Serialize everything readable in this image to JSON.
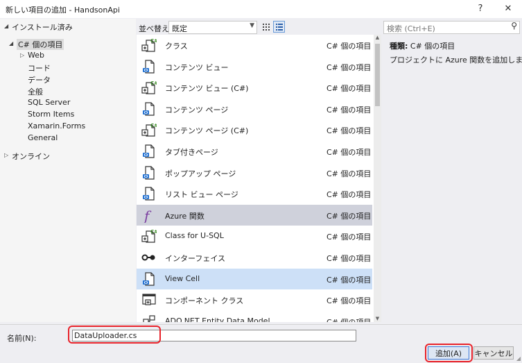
{
  "window": {
    "title": "新しい項目の追加 - HandsonApi",
    "help_glyph": "?",
    "close_glyph": "✕"
  },
  "tree": {
    "installed": {
      "label": "インストール済み",
      "expanded": true
    },
    "selected": "C# 個の項目",
    "items": [
      {
        "label": "C# 個の項目",
        "selected": true
      },
      {
        "label": "Web",
        "expandable": true
      },
      {
        "label": "コード"
      },
      {
        "label": "データ"
      },
      {
        "label": "全般"
      },
      {
        "label": "SQL Server"
      },
      {
        "label": "Storm Items"
      },
      {
        "label": "Xamarin.Forms"
      },
      {
        "label": "General"
      }
    ],
    "online": {
      "label": "オンライン",
      "expanded": false
    }
  },
  "toolbar": {
    "sort_label": "並べ替え:",
    "sort_value": "既定",
    "search_placeholder": "検索 (Ctrl+E)"
  },
  "templates": [
    {
      "name": "クラス",
      "category": "C# 個の項目",
      "icon": "cs-class-icon"
    },
    {
      "name": "コンテンツ ビュー",
      "category": "C# 個の項目",
      "icon": "xaml-page-icon"
    },
    {
      "name": "コンテンツ ビュー (C#)",
      "category": "C# 個の項目",
      "icon": "cs-class-icon"
    },
    {
      "name": "コンテンツ ページ",
      "category": "C# 個の項目",
      "icon": "xaml-page-icon"
    },
    {
      "name": "コンテンツ ページ (C#)",
      "category": "C# 個の項目",
      "icon": "cs-class-icon"
    },
    {
      "name": "タブ付きページ",
      "category": "C# 個の項目",
      "icon": "xaml-page-icon"
    },
    {
      "name": "ポップアップ ページ",
      "category": "C# 個の項目",
      "icon": "xaml-page-icon"
    },
    {
      "name": "リスト ビュー ページ",
      "category": "C# 個の項目",
      "icon": "xaml-page-icon"
    },
    {
      "name": "Azure 関数",
      "category": "C# 個の項目",
      "icon": "azure-function-icon",
      "state": "selected"
    },
    {
      "name": "Class for U-SQL",
      "category": "C# 個の項目",
      "icon": "cs-class-icon"
    },
    {
      "name": "インターフェイス",
      "category": "C# 個の項目",
      "icon": "interface-icon"
    },
    {
      "name": "View Cell",
      "category": "C# 個の項目",
      "icon": "xaml-page-icon",
      "state": "hover"
    },
    {
      "name": "コンポーネント クラス",
      "category": "C# 個の項目",
      "icon": "component-class-icon"
    },
    {
      "name": "ADO.NET Entity Data Model",
      "category": "C# 個の項目",
      "icon": "entity-model-icon"
    }
  ],
  "detail": {
    "type_label": "種類:",
    "type_value": "C# 個の項目",
    "description": "プロジェクトに Azure 関数を追加します。"
  },
  "footer": {
    "name_label": "名前(N):",
    "name_value": "DataUploader.cs",
    "add_label": "追加(A)",
    "cancel_label": "キャンセル"
  },
  "colors": {
    "highlight_red": "#e8222a",
    "selected_row": "#cfd1db",
    "hover_row": "#cde0f7",
    "csharp_green": "#3f8f2b",
    "azure_function_purple": "#7b3fa0"
  }
}
